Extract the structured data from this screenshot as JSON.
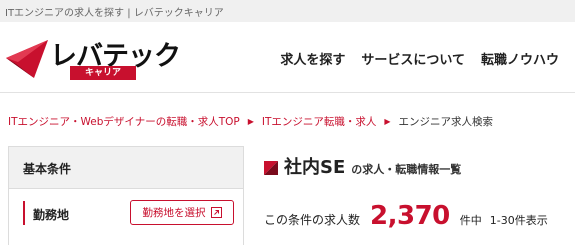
{
  "page": {
    "top_text": "ITエンジニアの求人を探す | レバテックキャリア"
  },
  "header": {
    "logo_text": "レバテック",
    "logo_sub": "キャリア",
    "nav": [
      {
        "label": "求人を探す"
      },
      {
        "label": "サービスについて"
      },
      {
        "label": "転職ノウハウ"
      }
    ]
  },
  "breadcrumb": {
    "items": [
      {
        "label": "ITエンジニア・Webデザイナーの転職・求人TOP"
      },
      {
        "label": "ITエンジニア転職・求人"
      },
      {
        "label": "エンジニア求人検索"
      }
    ],
    "separator": "▶"
  },
  "sidebar": {
    "heading": "基本条件",
    "rows": [
      {
        "label": "勤務地",
        "button_label": "勤務地を選択"
      }
    ]
  },
  "results": {
    "title": "社内SE",
    "subtitle": "の求人・転職情報一覧",
    "count_label": "この条件の求人数",
    "count": "2,370",
    "count_unit": "件中",
    "range": "1-30件表示"
  },
  "colors": {
    "accent": "#c8102e",
    "topbar_bg": "#f0f0f0",
    "side_head_bg": "#f1f1f1"
  }
}
